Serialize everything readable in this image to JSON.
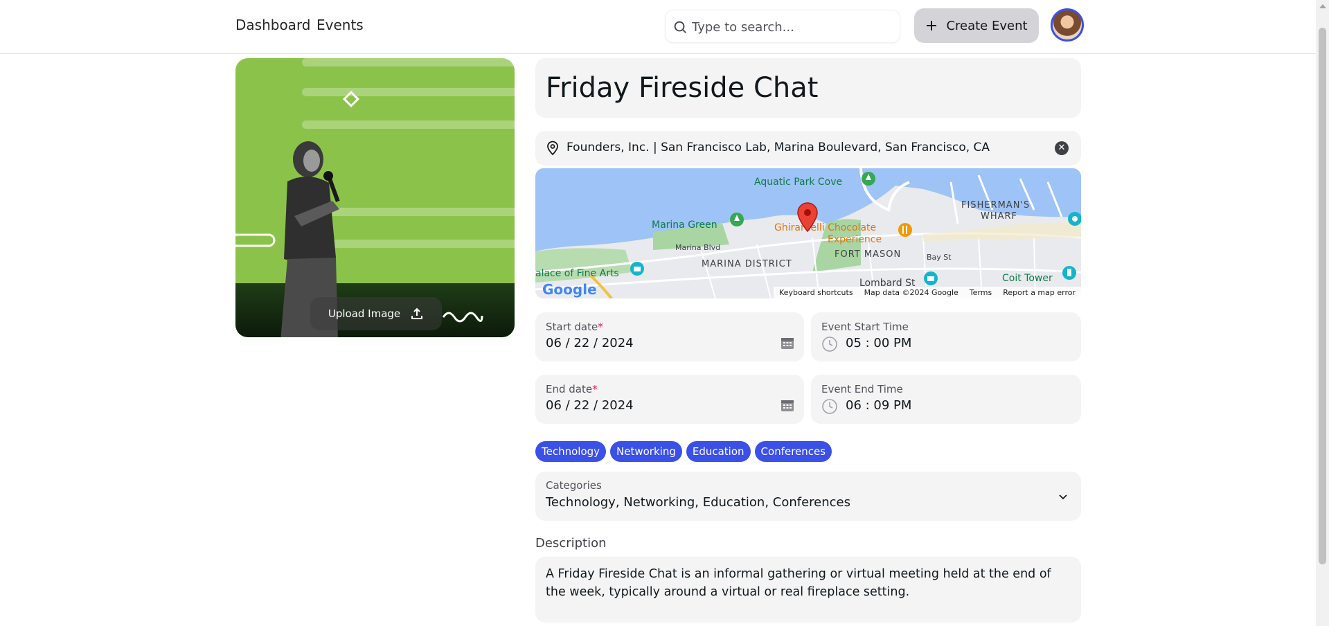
{
  "nav": {
    "dashboard": "Dashboard",
    "events": "Events"
  },
  "search": {
    "placeholder": "Type to search..."
  },
  "header": {
    "create_label": "Create Event"
  },
  "image": {
    "upload_label": "Upload Image"
  },
  "event": {
    "title": "Friday Fireside Chat",
    "location": "Founders, Inc. | San Francisco Lab, Marina Boulevard, San Francisco, CA"
  },
  "map": {
    "labels": {
      "aquatic": "Aquatic Park Cove",
      "fisherman1": "FISHERMAN'S",
      "fisherman2": "WHARF",
      "marina_green": "Marina Green",
      "ghirardelli1": "Ghirardelli Chocolate",
      "ghirardelli2": "Experience",
      "marina_blvd": "Marina Blvd",
      "fort_mason": "FORT MASON",
      "bay_st": "Bay St",
      "marina_district": "MARINA DISTRICT",
      "palace": "alace of Fine Arts",
      "lombard": "Lombard St",
      "coit": "Coit Tower",
      "google": "Google"
    },
    "footer": {
      "shortcuts": "Keyboard shortcuts",
      "data": "Map data ©2024 Google",
      "terms": "Terms",
      "report": "Report a map error"
    }
  },
  "start_date": {
    "label": "Start date",
    "required": "*",
    "value": "06 / 22 / 2024"
  },
  "start_time": {
    "label": "Event Start Time",
    "value": "05 : 00  PM"
  },
  "end_date": {
    "label": "End date",
    "required": "*",
    "value": "06 / 22 / 2024"
  },
  "end_time": {
    "label": "Event End Time",
    "value": "06 : 09  PM"
  },
  "tags": [
    "Technology",
    "Networking",
    "Education",
    "Conferences"
  ],
  "categories": {
    "label": "Categories",
    "value": "Technology, Networking, Education, Conferences"
  },
  "description": {
    "label": "Description",
    "value": "A Friday Fireside Chat is an informal gathering or virtual meeting held at the end of the week, typically around a virtual or real fireplace setting."
  },
  "colors": {
    "accent": "#3b50e6",
    "image_bg": "#8bc34a",
    "field_bg": "#f4f4f5",
    "required": "#f31260"
  }
}
